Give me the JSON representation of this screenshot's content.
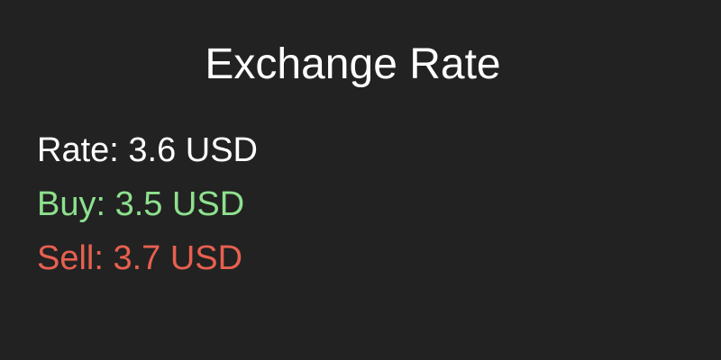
{
  "widget": {
    "title": "Exchange Rate",
    "rate_text": "Rate: 3.6 USD",
    "buy_text": "Buy: 3.5 USD",
    "sell_text": "Sell: 3.7 USD"
  },
  "colors": {
    "background": "#222222",
    "rate": "#ffffff",
    "buy": "#8ee08e",
    "sell": "#e86050"
  }
}
